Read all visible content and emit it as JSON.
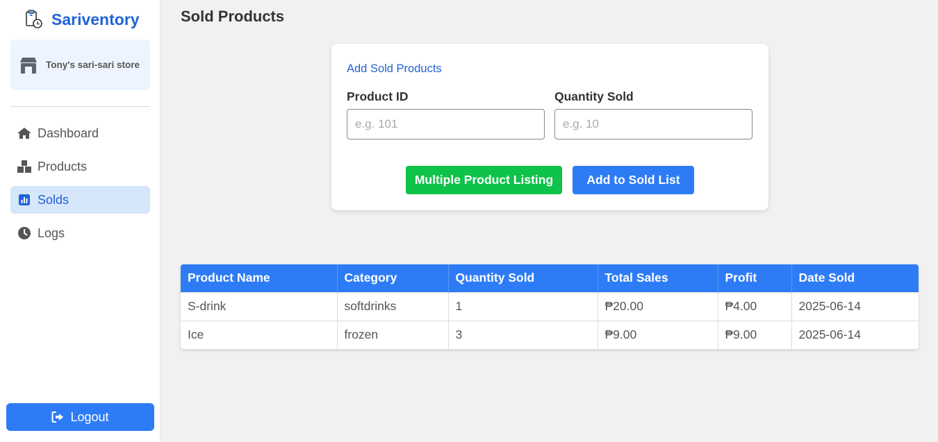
{
  "app": {
    "title": "Sariventory",
    "store_name": "Tony's sari-sari store"
  },
  "sidebar": {
    "items": [
      {
        "label": "Dashboard",
        "icon": "home-icon",
        "active": false
      },
      {
        "label": "Products",
        "icon": "boxes-icon",
        "active": false
      },
      {
        "label": "Solds",
        "icon": "chart-icon",
        "active": true
      },
      {
        "label": "Logs",
        "icon": "clock-icon",
        "active": false
      }
    ],
    "logout_label": "Logout"
  },
  "page": {
    "title": "Sold Products"
  },
  "form": {
    "heading": "Add Sold Products",
    "product_id_label": "Product ID",
    "product_id_placeholder": "e.g. 101",
    "product_id_value": "",
    "quantity_label": "Quantity Sold",
    "quantity_placeholder": "e.g. 10",
    "quantity_value": "",
    "multiple_button": "Multiple Product Listing",
    "add_button": "Add to Sold List"
  },
  "table": {
    "columns": [
      "Product Name",
      "Category",
      "Quantity Sold",
      "Total Sales",
      "Profit",
      "Date Sold"
    ],
    "rows": [
      [
        "S-drink",
        "softdrinks",
        "1",
        "₱20.00",
        "₱4.00",
        "2025-06-14"
      ],
      [
        "Ice",
        "frozen",
        "3",
        "₱9.00",
        "₱9.00",
        "2025-06-14"
      ]
    ]
  },
  "colors": {
    "accent": "#2e7cf5",
    "brand": "#1f63d8",
    "success": "#0fc24a",
    "active_bg": "#d6e6fb"
  }
}
